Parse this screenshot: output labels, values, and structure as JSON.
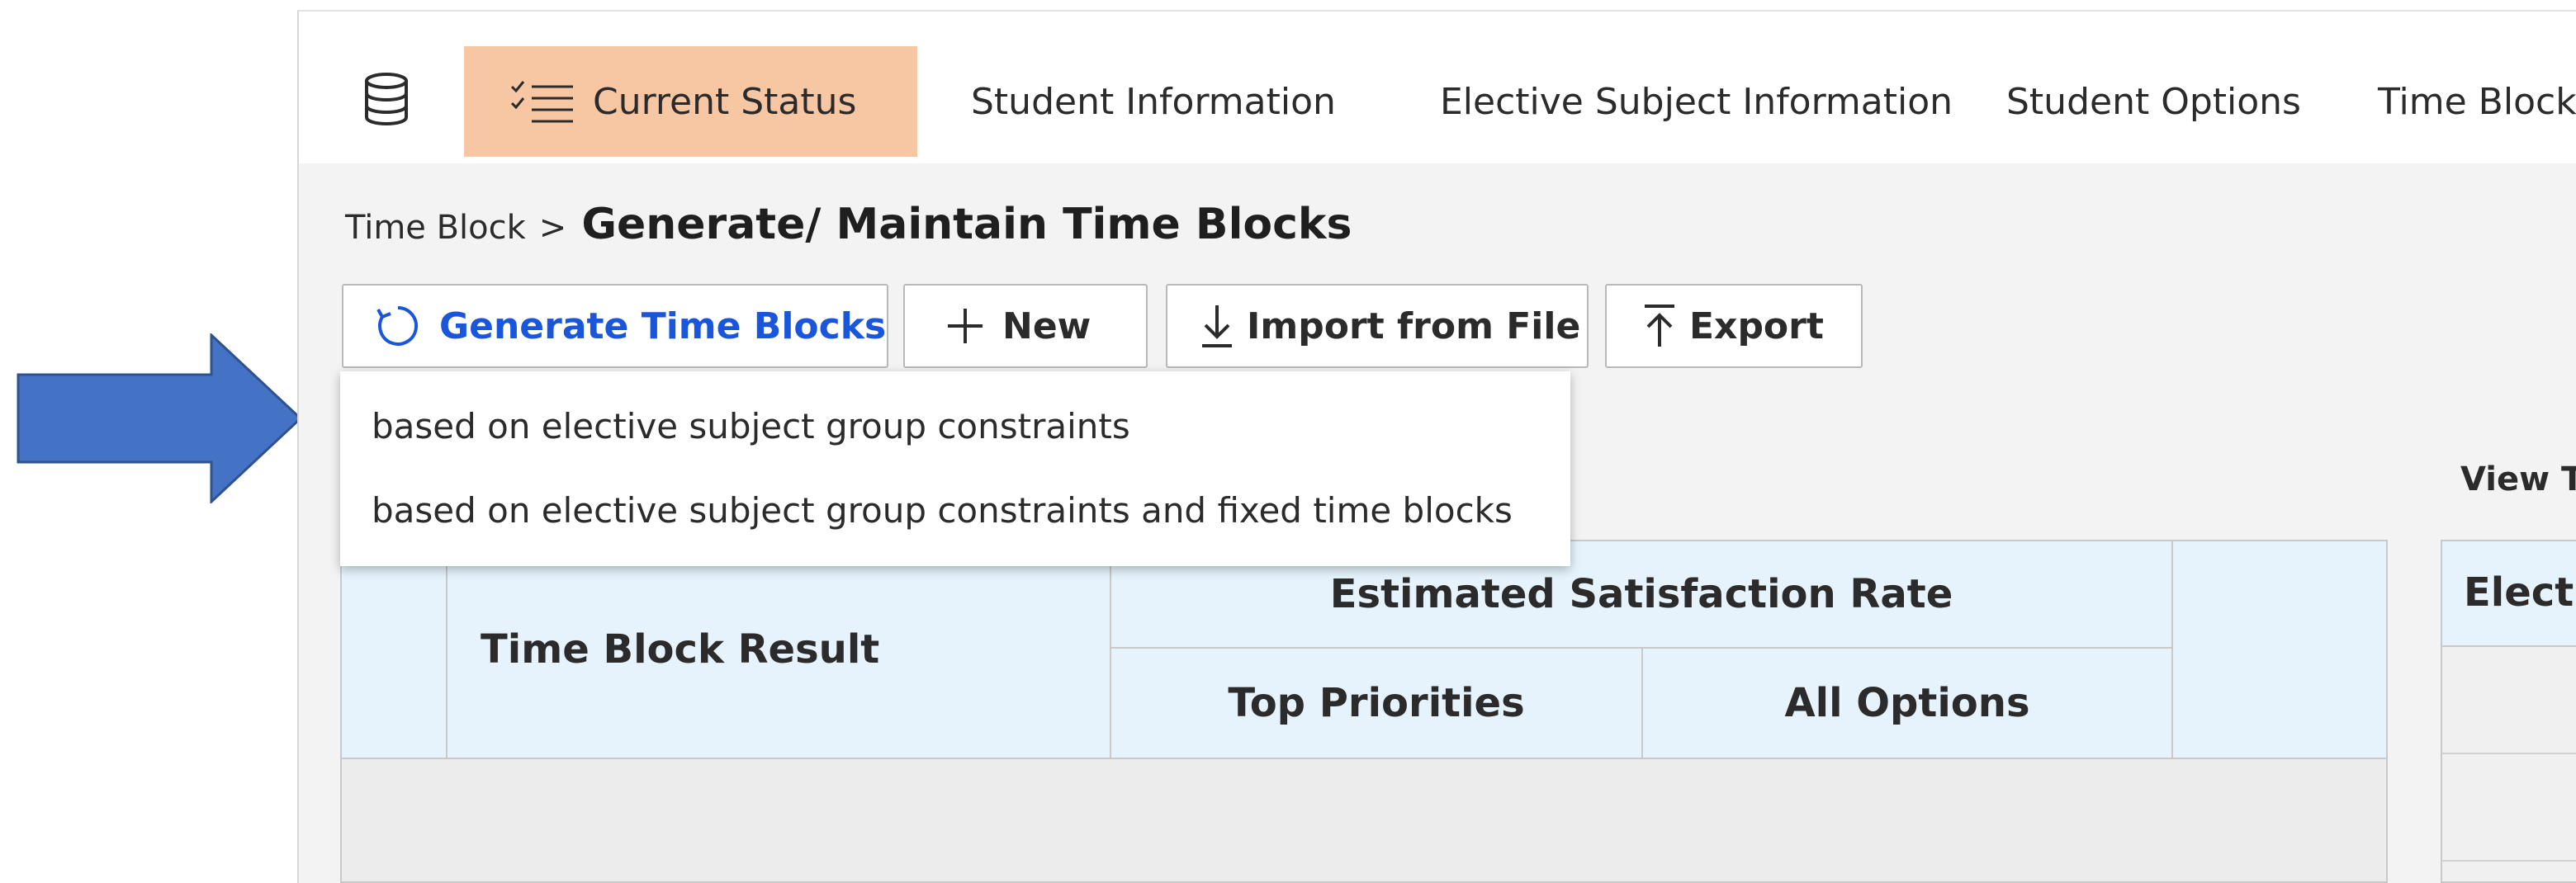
{
  "nav": {
    "items": [
      {
        "label": "Current Status",
        "active": true
      },
      {
        "label": "Student Information"
      },
      {
        "label": "Elective Subject Information"
      },
      {
        "label": "Student Options"
      },
      {
        "label": "Time Block"
      }
    ]
  },
  "breadcrumb": {
    "parent": "Time Block",
    "separator": ">",
    "title": "Generate/ Maintain Time Blocks"
  },
  "toolbar": {
    "generate_label": "Generate Time Blocks",
    "new_label": "New",
    "import_label": "Import from File",
    "export_label": "Export"
  },
  "generate_menu": {
    "items": [
      "based on elective subject group constraints",
      "based on elective subject group constraints and fixed time blocks"
    ]
  },
  "results_table": {
    "headers": {
      "result": "Time Block Result",
      "satisfaction": "Estimated Satisfaction Rate",
      "top_priorities": "Top Priorities",
      "all_options": "All Options"
    }
  },
  "side_panel": {
    "view_label": "View T",
    "header": "Electi"
  },
  "colors": {
    "accent_blue": "#1a56db",
    "active_tab": "#f7c6a3",
    "header_fill": "#e6f3fc",
    "arrow_fill": "#4472c4"
  },
  "icons": [
    "database-icon",
    "checklist-icon",
    "refresh-icon",
    "chevron-down-icon",
    "plus-icon",
    "download-icon",
    "upload-icon",
    "arrow-right-icon"
  ]
}
